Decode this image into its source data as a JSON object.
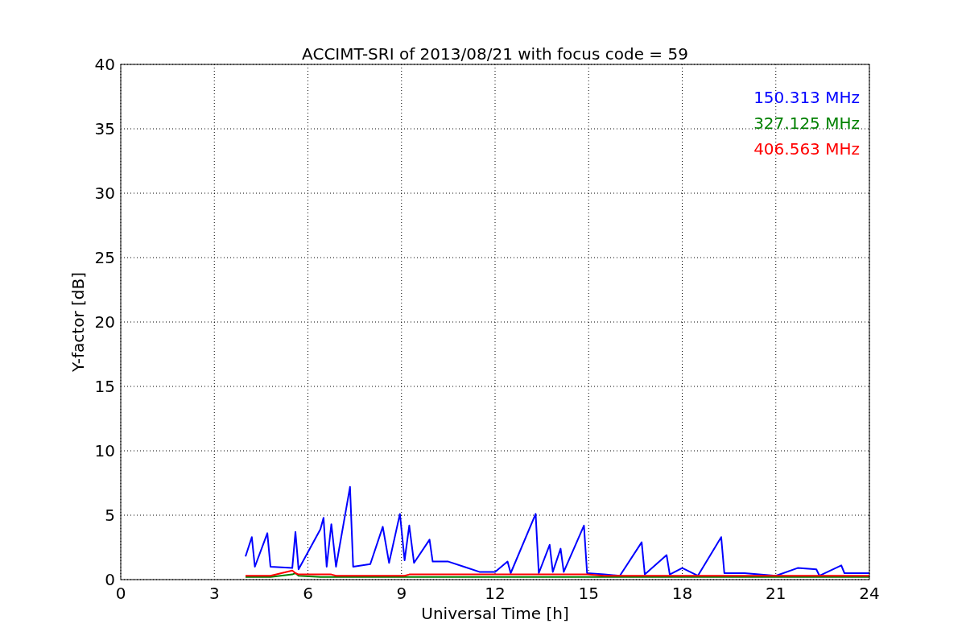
{
  "chart_data": {
    "type": "line",
    "title": "ACCIMT-SRI of 2013/08/21 with focus code = 59",
    "xlabel": "Universal Time [h]",
    "ylabel": "Y-factor [dB]",
    "x": [
      4.0,
      4.2,
      4.3,
      4.7,
      4.8,
      5.5,
      5.6,
      5.7,
      6.4,
      6.5,
      6.6,
      6.75,
      6.9,
      7.35,
      7.45,
      8.0,
      8.4,
      8.6,
      8.95,
      9.1,
      9.25,
      9.4,
      9.9,
      10.0,
      10.5,
      11.0,
      11.5,
      12.0,
      12.4,
      12.5,
      13.3,
      13.4,
      13.75,
      13.85,
      14.1,
      14.2,
      14.85,
      14.95,
      15.5,
      16.0,
      16.7,
      16.8,
      17.5,
      17.6,
      18.0,
      18.5,
      19.25,
      19.35,
      20.0,
      21.0,
      21.7,
      22.3,
      22.4,
      23.1,
      23.2,
      24.0
    ],
    "series": [
      {
        "name": "150.313 MHz",
        "color": "#0000ff",
        "values": [
          1.8,
          3.3,
          1.0,
          3.6,
          1.0,
          0.9,
          3.7,
          0.8,
          3.9,
          4.8,
          1.0,
          4.3,
          1.0,
          7.2,
          1.0,
          1.2,
          4.1,
          1.3,
          5.1,
          1.5,
          4.2,
          1.3,
          3.1,
          1.4,
          1.4,
          1.0,
          0.6,
          0.6,
          1.4,
          0.5,
          5.1,
          0.5,
          2.7,
          0.6,
          2.4,
          0.6,
          4.2,
          0.5,
          0.4,
          0.3,
          2.9,
          0.4,
          1.9,
          0.4,
          0.9,
          0.3,
          3.3,
          0.5,
          0.5,
          0.3,
          0.9,
          0.8,
          0.3,
          1.1,
          0.5,
          0.5
        ]
      },
      {
        "name": "327.125 MHz",
        "color": "#008000",
        "values": [
          0.2,
          0.2,
          0.2,
          0.2,
          0.2,
          0.4,
          0.5,
          0.3,
          0.2,
          0.2,
          0.2,
          0.2,
          0.2,
          0.2,
          0.2,
          0.2,
          0.2,
          0.2,
          0.2,
          0.2,
          0.2,
          0.2,
          0.2,
          0.2,
          0.2,
          0.2,
          0.2,
          0.2,
          0.2,
          0.2,
          0.2,
          0.2,
          0.2,
          0.2,
          0.2,
          0.2,
          0.2,
          0.2,
          0.2,
          0.2,
          0.2,
          0.2,
          0.2,
          0.2,
          0.2,
          0.2,
          0.2,
          0.2,
          0.2,
          0.2,
          0.2,
          0.2,
          0.2,
          0.2,
          0.2,
          0.2
        ]
      },
      {
        "name": "406.563 MHz",
        "color": "#ff0000",
        "values": [
          0.3,
          0.3,
          0.3,
          0.3,
          0.3,
          0.7,
          0.5,
          0.4,
          0.4,
          0.4,
          0.4,
          0.4,
          0.3,
          0.3,
          0.3,
          0.3,
          0.3,
          0.3,
          0.3,
          0.3,
          0.4,
          0.4,
          0.4,
          0.4,
          0.4,
          0.4,
          0.4,
          0.4,
          0.4,
          0.4,
          0.4,
          0.4,
          0.4,
          0.4,
          0.4,
          0.4,
          0.4,
          0.4,
          0.3,
          0.3,
          0.3,
          0.3,
          0.3,
          0.3,
          0.3,
          0.3,
          0.3,
          0.3,
          0.3,
          0.3,
          0.3,
          0.3,
          0.3,
          0.3,
          0.3,
          0.3
        ]
      }
    ],
    "grid": true,
    "xlim": [
      0,
      24
    ],
    "ylim": [
      0,
      40
    ],
    "xticks": [
      0,
      3,
      6,
      9,
      12,
      15,
      18,
      21,
      24
    ],
    "yticks": [
      0,
      5,
      10,
      15,
      20,
      25,
      30,
      35,
      40
    ]
  }
}
